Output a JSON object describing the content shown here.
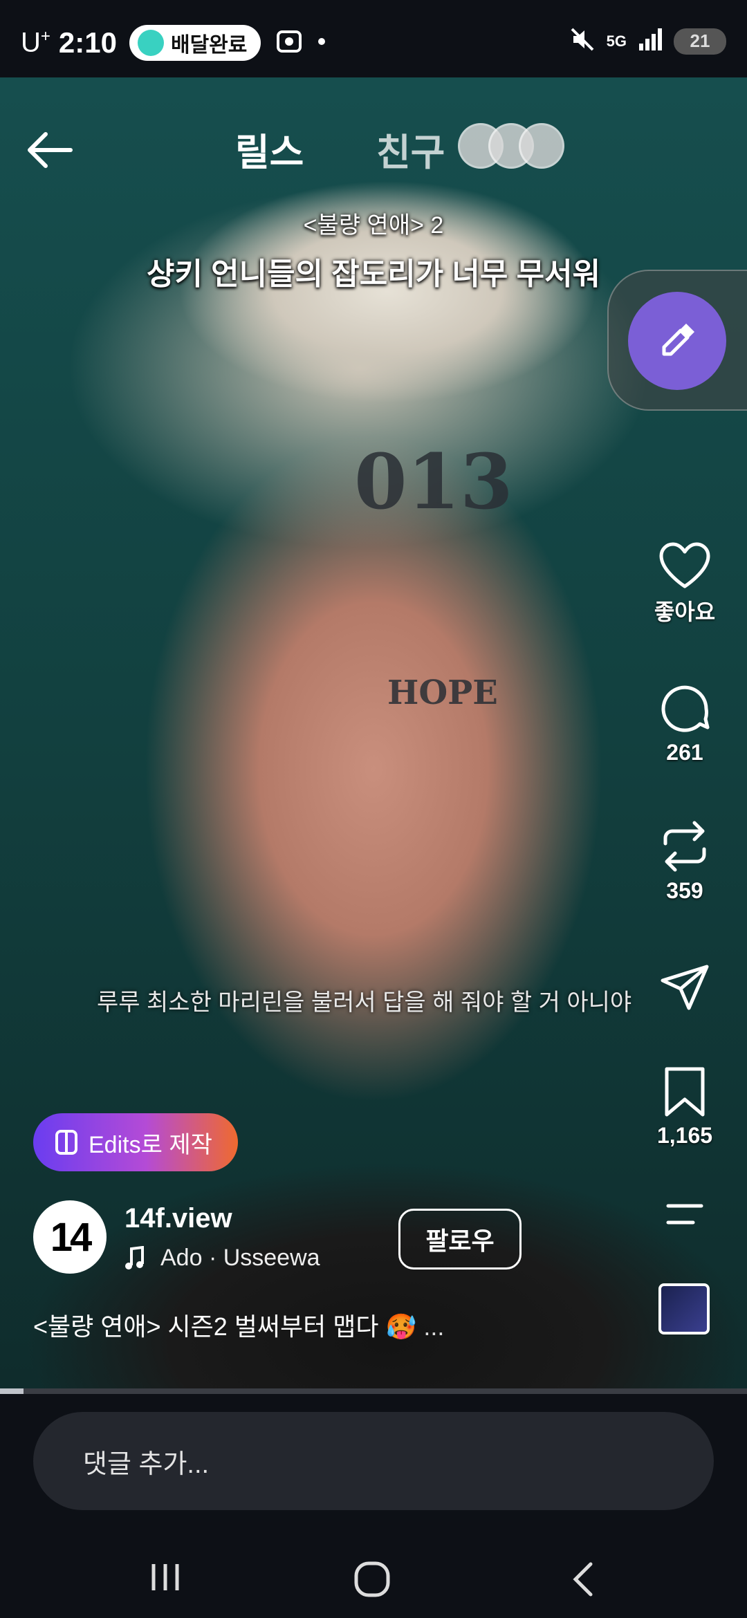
{
  "status_bar": {
    "carrier": "U",
    "carrier_sup": "+",
    "time": "2:10",
    "notification_pill": "배달완료",
    "network": "5G",
    "battery": "21"
  },
  "top_nav": {
    "tab_reels": "릴스",
    "tab_friends": "친구"
  },
  "video": {
    "title_line1": "<불량 연애> 2",
    "title_line2": "샹키 언니들의 잡도리가 너무 무서워",
    "subtitle": "루루  최소한 마리린을 불러서 답을 해 줘야 할 거 아니야",
    "tattoo_forehead": "013",
    "tattoo_cheek": "HOPE"
  },
  "actions": {
    "like_label": "좋아요",
    "comments_count": "261",
    "reposts_count": "359",
    "saves_count": "1,165"
  },
  "edits_button": "Edits로 제작",
  "account": {
    "avatar_text": "14",
    "name": "14f.view",
    "music": "Ado · Usseewa",
    "follow": "팔로우"
  },
  "description": "<불량 연애> 시즌2 벌써부터 맵다 🥵",
  "description_more": "...",
  "comment_placeholder": "댓글 추가...",
  "colors": {
    "accent_purple": "#7b5fd6",
    "edits_gradient_start": "#6a3df0",
    "edits_gradient_end": "#ef6a2f",
    "background": "#0d1016"
  },
  "icons": [
    "arrow-left-icon",
    "heart-icon",
    "comment-icon",
    "repost-icon",
    "send-icon",
    "bookmark-icon",
    "more-icon",
    "music-note-icon",
    "mute-icon",
    "wifi-signal-icon",
    "eyedropper-icon",
    "recents-icon",
    "home-icon",
    "back-nav-icon"
  ]
}
